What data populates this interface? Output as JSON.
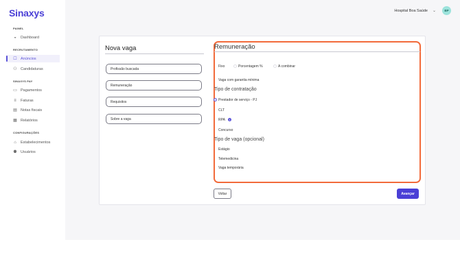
{
  "brand": {
    "name": "Sinaxys"
  },
  "header": {
    "hospital": "Hospital Boa Saúde",
    "avatar_initials": "BP"
  },
  "sidebar": {
    "sections": [
      {
        "title": "PAINEL",
        "items": [
          {
            "label": "Dashboard",
            "icon": "dashboard-icon"
          }
        ]
      },
      {
        "title": "RECRUTAMENTO",
        "items": [
          {
            "label": "Anúncios",
            "icon": "megaphone-icon",
            "active": true
          },
          {
            "label": "Candidaturas",
            "icon": "people-icon"
          }
        ]
      },
      {
        "title": "SINAXYS PAY",
        "items": [
          {
            "label": "Pagamentos",
            "icon": "payment-icon"
          },
          {
            "label": "Faturas",
            "icon": "invoice-icon"
          },
          {
            "label": "Notas fiscais",
            "icon": "receipt-icon"
          },
          {
            "label": "Relatórios",
            "icon": "report-icon"
          }
        ]
      },
      {
        "title": "CONFIGURAÇÕES",
        "items": [
          {
            "label": "Estabelecimentos",
            "icon": "building-icon"
          },
          {
            "label": "Usuários",
            "icon": "users-icon"
          }
        ]
      }
    ]
  },
  "form": {
    "title": "Nova vaga",
    "steps": [
      "Profissão buscada",
      "Remuneração",
      "Requisitos",
      "Sobre a vaga"
    ]
  },
  "remuneracao": {
    "title": "Remuneração",
    "pay_options": [
      "Fixo",
      "Porcentagem %",
      "A combinar"
    ],
    "garantia": "Vaga com garantia mínima",
    "contract_title": "Tipo de contratação",
    "contract_options": [
      "Prestador de serviço - PJ",
      "CLT",
      "RPA",
      "Concurso"
    ],
    "contract_selected": "Prestador de serviço - PJ",
    "vaga_title": "Tipo de vaga (opcional)",
    "vaga_options": [
      "Estágio",
      "Telemedicina",
      "Vaga temporária"
    ]
  },
  "actions": {
    "back": "Voltar",
    "next": "Avançar"
  },
  "colors": {
    "accent": "#4a3fd6",
    "highlight_border": "#f26a3a",
    "avatar_bg": "#9ce3dc"
  }
}
